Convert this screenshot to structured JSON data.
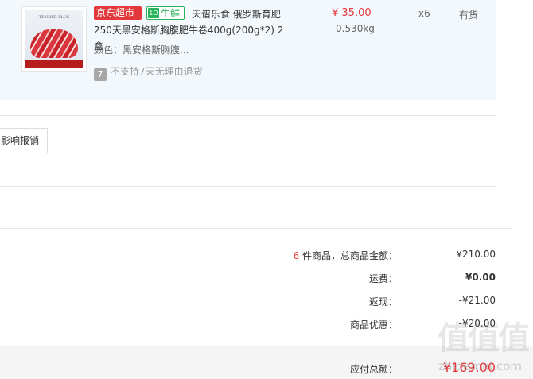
{
  "item": {
    "jd_tag": "京东超市",
    "fresh_tag": "生鲜",
    "title": "天谱乐食 俄罗斯育肥250天黑安格斯胸腹肥牛卷400g(200g*2) 2盒",
    "color_label": "颜色：黑安格斯胸腹...",
    "no_return_badge": "7",
    "no_return_text": "不支持7天无理由退货",
    "price": "¥ 35.00",
    "weight": "0.530kg",
    "quantity": "x6",
    "stock": "有货",
    "thumb_brand": "TENDER PLUS"
  },
  "invoice_button": "影响报销",
  "summary": {
    "count": "6",
    "count_suffix": " 件商品，总商品金额：",
    "goods_total": "¥210.00",
    "shipping_label": "运费：",
    "shipping_value": "¥0.00",
    "cashback_label": "返现：",
    "cashback_value": "-¥21.00",
    "discount_label": "商品优惠：",
    "discount_value": "-¥20.00",
    "payable_label": "应付总额：",
    "payable_value": "¥169.00"
  },
  "watermark": {
    "logo": "值值值",
    "url": "zhidemai.com"
  },
  "colors": {
    "accent_red": "#e4393c",
    "fresh_green": "#29b35b",
    "item_bg": "#f3f8fd"
  }
}
